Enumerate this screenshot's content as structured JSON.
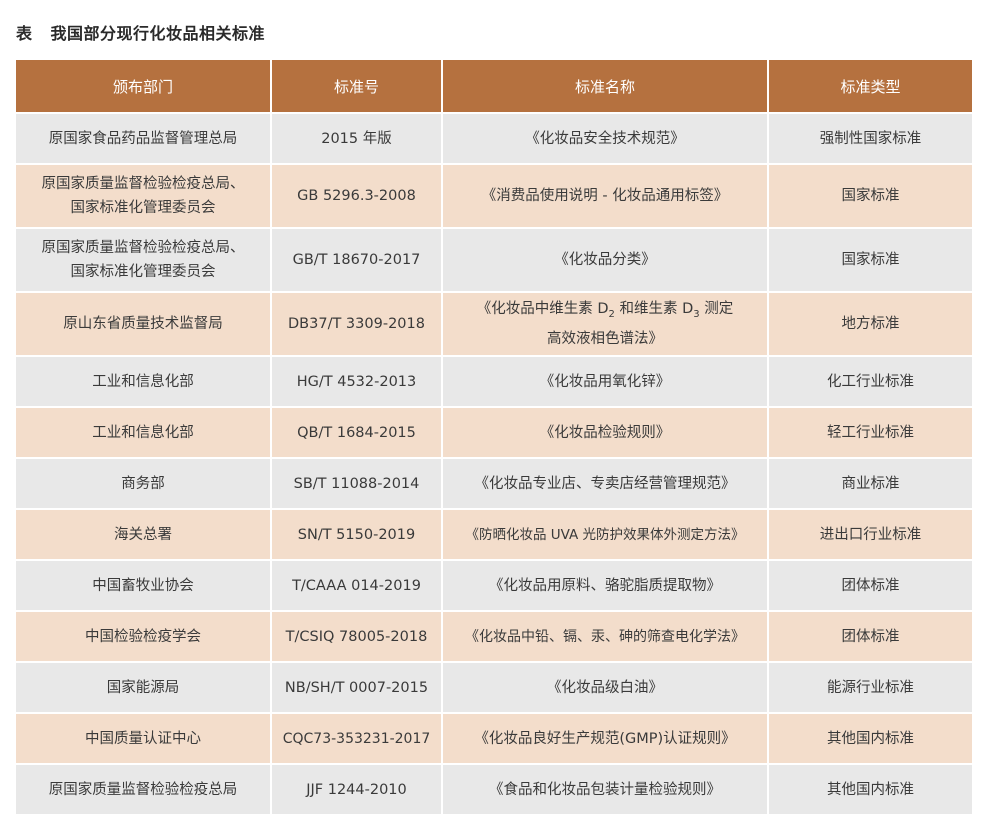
{
  "caption": {
    "label": "表",
    "title": "我国部分现行化妆品相关标准"
  },
  "table": {
    "headers": [
      "颁布部门",
      "标准号",
      "标准名称",
      "标准类型"
    ],
    "rows": [
      {
        "dept": "原国家食品药品监督管理总局",
        "dept2": "",
        "code": "2015 年版",
        "name": "《化妆品安全技术规范》",
        "name2": "",
        "type": "强制性国家标准"
      },
      {
        "dept": "原国家质量监督检验检疫总局、",
        "dept2": "国家标准化管理委员会",
        "code": "GB 5296.3-2008",
        "name": "《消费品使用说明 - 化妆品通用标签》",
        "name2": "",
        "type": "国家标准"
      },
      {
        "dept": "原国家质量监督检验检疫总局、",
        "dept2": "国家标准化管理委员会",
        "code": "GB/T 18670-2017",
        "name": "《化妆品分类》",
        "name2": "",
        "type": "国家标准"
      },
      {
        "dept": "原山东省质量技术监督局",
        "dept2": "",
        "code": "DB37/T 3309-2018",
        "name_a": "《化妆品中维生素 D",
        "name_sub1": "2",
        "name_b": " 和维生素 D",
        "name_sub2": "3",
        "name_c": " 测定",
        "name2": "高效液相色谱法》",
        "type": "地方标准"
      },
      {
        "dept": "工业和信息化部",
        "dept2": "",
        "code": "HG/T 4532-2013",
        "name": "《化妆品用氧化锌》",
        "name2": "",
        "type": "化工行业标准"
      },
      {
        "dept": "工业和信息化部",
        "dept2": "",
        "code": "QB/T 1684-2015",
        "name": "《化妆品检验规则》",
        "name2": "",
        "type": "轻工行业标准"
      },
      {
        "dept": "商务部",
        "dept2": "",
        "code": "SB/T 11088-2014",
        "name": "《化妆品专业店、专卖店经营管理规范》",
        "name2": "",
        "type": "商业标准"
      },
      {
        "dept": "海关总署",
        "dept2": "",
        "code": "SN/T 5150-2019",
        "name": "《防晒化妆品 UVA 光防护效果体外测定方法》",
        "name2": "",
        "type": "进出口行业标准"
      },
      {
        "dept": "中国畜牧业协会",
        "dept2": "",
        "code": "T/CAAA 014-2019",
        "name": "《化妆品用原料、骆驼脂质提取物》",
        "name2": "",
        "type": "团体标准"
      },
      {
        "dept": "中国检验检疫学会",
        "dept2": "",
        "code": "T/CSIQ 78005-2018",
        "name": "《化妆品中铅、镉、汞、砷的筛查电化学法》",
        "name2": "",
        "type": "团体标准"
      },
      {
        "dept": "国家能源局",
        "dept2": "",
        "code": "NB/SH/T 0007-2015",
        "name": "《化妆品级白油》",
        "name2": "",
        "type": "能源行业标准"
      },
      {
        "dept": "中国质量认证中心",
        "dept2": "",
        "code": "CQC73-353231-2017",
        "name": "《化妆品良好生产规范(GMP)认证规则》",
        "name2": "",
        "type": "其他国内标准"
      },
      {
        "dept": "原国家质量监督检验检疫总局",
        "dept2": "",
        "code": "JJF 1244-2010",
        "name": "《食品和化妆品包装计量检验规则》",
        "name2": "",
        "type": "其他国内标准"
      }
    ]
  },
  "colors": {
    "header_bg": "#b5713f",
    "row_gray": "#e8e8e8",
    "row_peach": "#f3ddcb"
  }
}
